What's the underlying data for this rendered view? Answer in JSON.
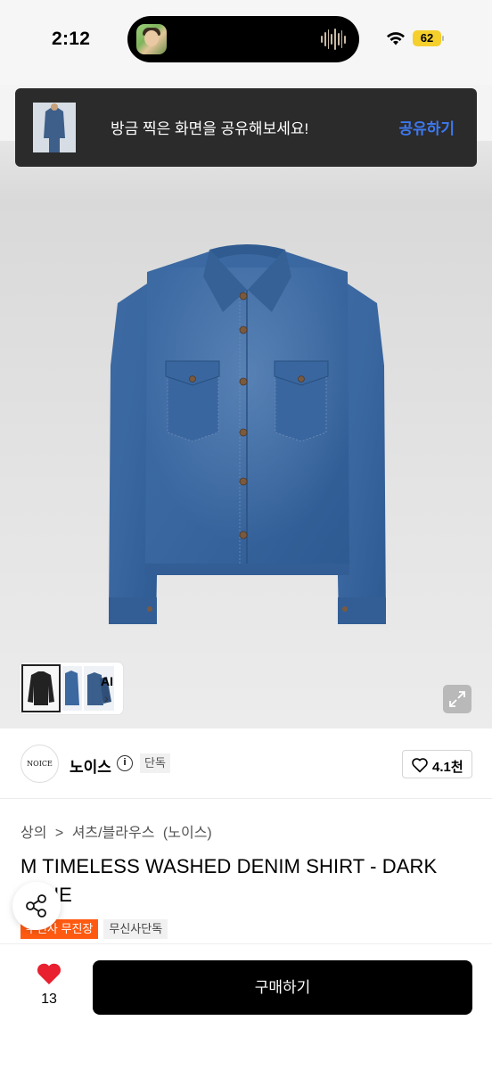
{
  "status_bar": {
    "time": "2:12",
    "battery": "62"
  },
  "toast": {
    "message": "방금 찍은 화면을 공유해보세요!",
    "action_label": "공유하기"
  },
  "gallery": {
    "ai_label": "AI",
    "ai_chevron": "›"
  },
  "brand": {
    "logo_text": "NOICE",
    "name": "노이스",
    "info_glyph": "i",
    "badge": "단독",
    "likes": "4.1천"
  },
  "breadcrumb": {
    "items": [
      "상의",
      ">",
      "셔츠/블라우스",
      "(노이스)"
    ]
  },
  "product": {
    "title": "M TIMELESS WASHED DENIM SHIRT - DARK BLUE"
  },
  "badges": {
    "store": "무신사 무진장",
    "exclusive": "무신사단독"
  },
  "bottom": {
    "wish_count": "13",
    "buy_label": "구매하기"
  },
  "colors": {
    "accent_blue": "#3d78f0",
    "buy_button": "#000000",
    "store_badge": "#ff5a11",
    "wish_heart": "#e8202f",
    "battery": "#f5cf2c"
  },
  "icons": [
    "wifi-icon",
    "battery-icon",
    "info-icon",
    "heart-outline-icon",
    "heart-filled-icon",
    "share-icon",
    "expand-icon"
  ]
}
